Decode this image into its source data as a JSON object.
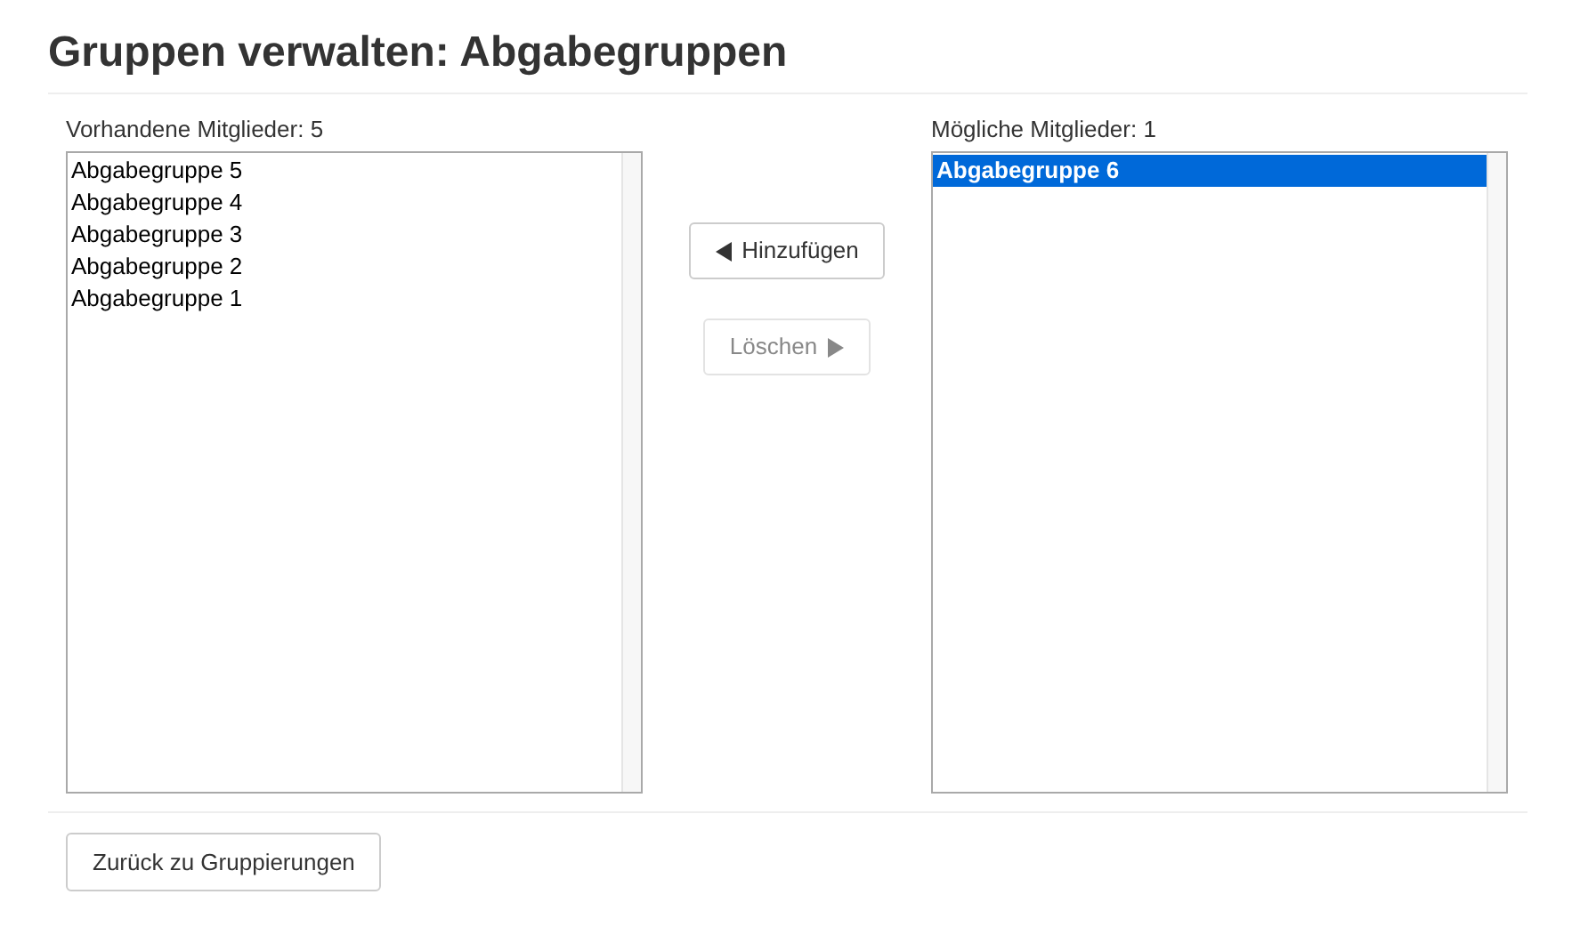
{
  "title": "Gruppen verwalten: Abgabegruppen",
  "current_members": {
    "label": "Vorhandene Mitglieder: 5",
    "items": [
      {
        "text": "Abgabegruppe 5",
        "selected": false
      },
      {
        "text": "Abgabegruppe 4",
        "selected": false
      },
      {
        "text": "Abgabegruppe 3",
        "selected": false
      },
      {
        "text": "Abgabegruppe 2",
        "selected": false
      },
      {
        "text": "Abgabegruppe 1",
        "selected": false
      }
    ]
  },
  "actions": [
    {
      "label": "Hinzufügen",
      "kind": "add",
      "disabled": false
    },
    {
      "label": "Löschen",
      "kind": "remove",
      "disabled": true
    }
  ],
  "possible_members": {
    "label": "Mögliche Mitglieder: 1",
    "items": [
      {
        "text": "Abgabegruppe 6",
        "selected": true
      }
    ]
  },
  "back_button": "Zurück zu Gruppierungen"
}
